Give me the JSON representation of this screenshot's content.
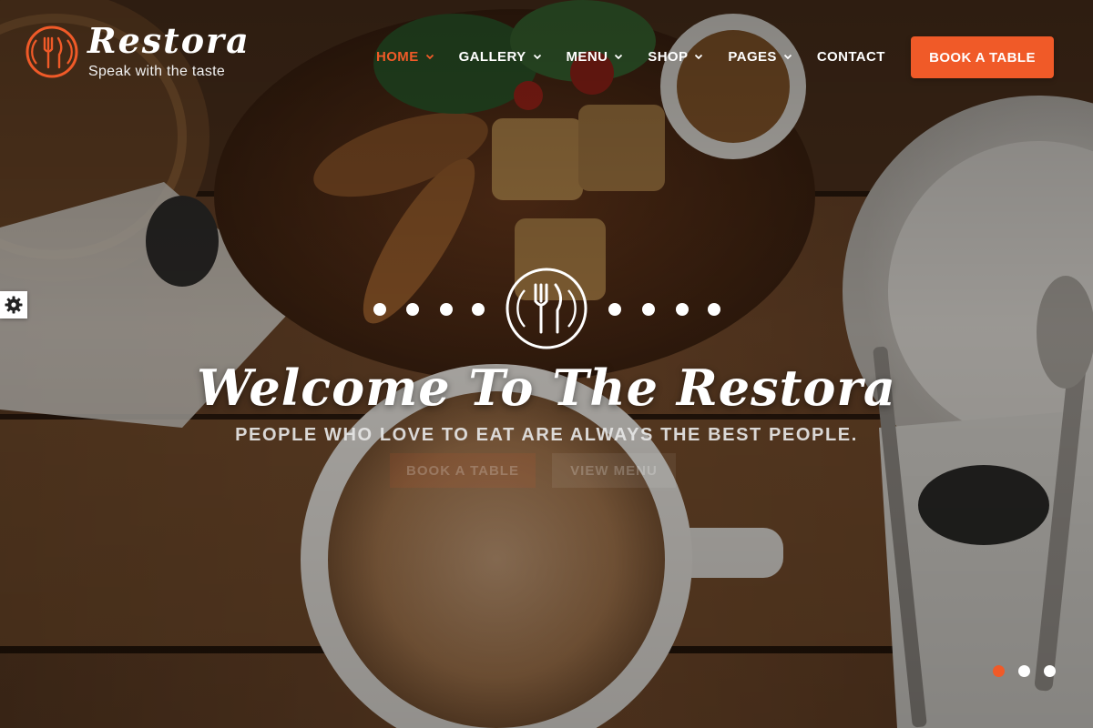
{
  "brand": {
    "name": "Restora",
    "tagline": "Speak with the taste",
    "logo_icon": "cutlery-circle-icon"
  },
  "colors": {
    "accent": "#f05a28",
    "text_light": "#ffffff"
  },
  "nav": {
    "items": [
      {
        "label": "HOME",
        "has_dropdown": true,
        "active": true
      },
      {
        "label": "GALLERY",
        "has_dropdown": true,
        "active": false
      },
      {
        "label": "MENU",
        "has_dropdown": true,
        "active": false
      },
      {
        "label": "SHOP",
        "has_dropdown": true,
        "active": false
      },
      {
        "label": "PAGES",
        "has_dropdown": true,
        "active": false
      },
      {
        "label": "CONTACT",
        "has_dropdown": false,
        "active": false
      }
    ],
    "book_button": "BOOK A TABLE"
  },
  "settings": {
    "icon": "gear-icon"
  },
  "hero": {
    "emblem_icon": "fork-knife-plate-icon",
    "title": "Welcome To The Restora",
    "subtitle": "PEOPLE WHO LOVE TO EAT ARE ALWAYS THE BEST PEOPLE.",
    "primary_cta": "BOOK A TABLE",
    "secondary_cta": "VIEW MENU"
  },
  "slider": {
    "slides": 3,
    "active_index": 0
  }
}
